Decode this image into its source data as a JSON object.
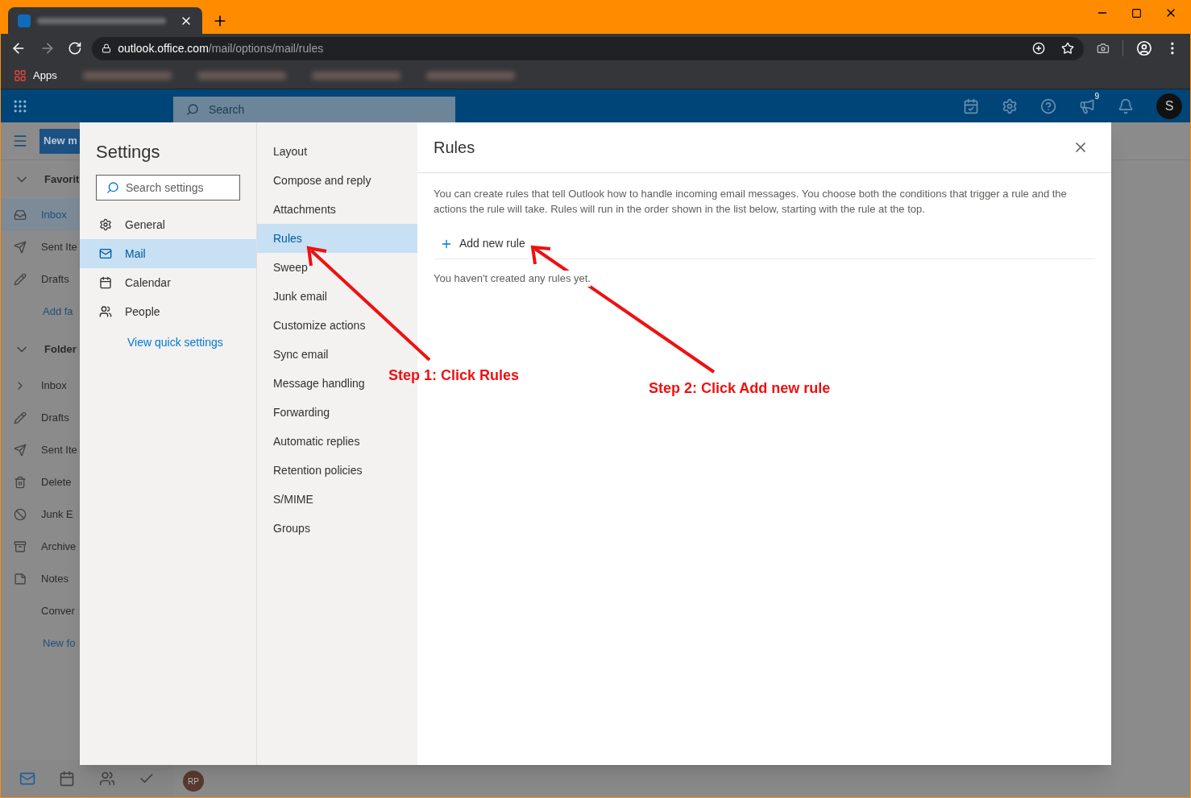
{
  "browser": {
    "address": {
      "host": "outlook.office.com",
      "path": "/mail/options/mail/rules"
    },
    "bookmarks": [
      "Apps"
    ]
  },
  "outlook": {
    "search": {
      "placeholder": "Search"
    },
    "notification_badge": "9",
    "avatar": "S",
    "new_button": "New m",
    "favorites": {
      "header": "Favorit",
      "items": [
        {
          "label": "Inbox",
          "selected": true
        },
        {
          "label": "Sent Ite",
          "selected": false
        },
        {
          "label": "Drafts",
          "selected": false
        }
      ],
      "link": "Add fa"
    },
    "folders": {
      "header": "Folder",
      "items": [
        {
          "label": "Inbox"
        },
        {
          "label": "Drafts"
        },
        {
          "label": "Sent Ite"
        },
        {
          "label": "Delete"
        },
        {
          "label": "Junk E"
        },
        {
          "label": "Archive"
        },
        {
          "label": "Notes"
        },
        {
          "label": "Conver"
        }
      ],
      "link": "New fo"
    },
    "bottom_nav": [
      {
        "selected": true
      },
      {
        "selected": false
      },
      {
        "selected": false
      },
      {
        "selected": false
      }
    ],
    "message_avatar": "RP"
  },
  "settings": {
    "title": "Settings",
    "search": {
      "placeholder": "Search settings"
    },
    "categories": [
      {
        "label": "General",
        "selected": false
      },
      {
        "label": "Mail",
        "selected": true
      },
      {
        "label": "Calendar",
        "selected": false
      },
      {
        "label": "People",
        "selected": false
      }
    ],
    "quick_settings_link": "View quick settings",
    "subcategories": [
      {
        "label": "Layout",
        "selected": false
      },
      {
        "label": "Compose and reply",
        "selected": false
      },
      {
        "label": "Attachments",
        "selected": false
      },
      {
        "label": "Rules",
        "selected": true
      },
      {
        "label": "Sweep",
        "selected": false
      },
      {
        "label": "Junk email",
        "selected": false
      },
      {
        "label": "Customize actions",
        "selected": false
      },
      {
        "label": "Sync email",
        "selected": false
      },
      {
        "label": "Message handling",
        "selected": false
      },
      {
        "label": "Forwarding",
        "selected": false
      },
      {
        "label": "Automatic replies",
        "selected": false
      },
      {
        "label": "Retention policies",
        "selected": false
      },
      {
        "label": "S/MIME",
        "selected": false
      },
      {
        "label": "Groups",
        "selected": false
      }
    ],
    "panel": {
      "title": "Rules",
      "description": "You can create rules that tell Outlook how to handle incoming email messages. You choose both the conditions that trigger a rule and the actions the rule will take. Rules will run in the order shown in the list below, starting with the rule at the top.",
      "add_button": "Add new rule",
      "empty_message": "You haven't created any rules yet."
    }
  },
  "annotations": [
    {
      "text": "Step 1: Click Rules"
    },
    {
      "text": "Step 2: Click Add new rule"
    }
  ]
}
